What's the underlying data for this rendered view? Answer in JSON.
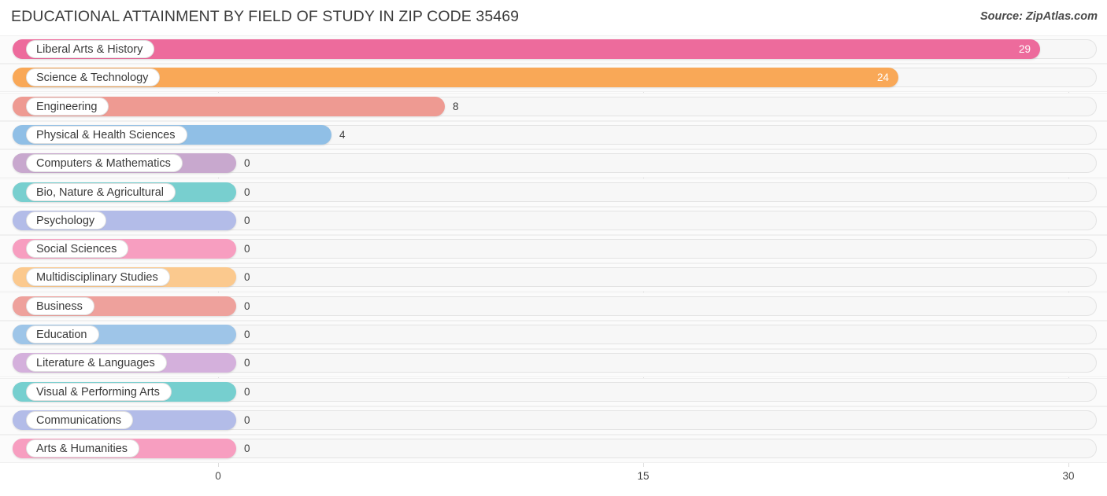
{
  "header": {
    "title": "EDUCATIONAL ATTAINMENT BY FIELD OF STUDY IN ZIP CODE 35469",
    "source": "Source: ZipAtlas.com"
  },
  "chart_data": {
    "type": "bar",
    "orientation": "horizontal",
    "title": "EDUCATIONAL ATTAINMENT BY FIELD OF STUDY IN ZIP CODE 35469",
    "xlabel": "",
    "ylabel": "",
    "xlim": [
      0,
      30
    ],
    "xticks": [
      "0",
      "15",
      "30"
    ],
    "grid": true,
    "legend": "none",
    "categories": [
      "Liberal Arts & History",
      "Science & Technology",
      "Engineering",
      "Physical & Health Sciences",
      "Computers & Mathematics",
      "Bio, Nature & Agricultural",
      "Psychology",
      "Social Sciences",
      "Multidisciplinary Studies",
      "Business",
      "Education",
      "Literature & Languages",
      "Visual & Performing Arts",
      "Communications",
      "Arts & Humanities"
    ],
    "values": [
      29,
      24,
      8,
      4,
      0,
      0,
      0,
      0,
      0,
      0,
      0,
      0,
      0,
      0,
      0
    ],
    "value_labels": [
      "29",
      "24",
      "8",
      "4",
      "0",
      "0",
      "0",
      "0",
      "0",
      "0",
      "0",
      "0",
      "0",
      "0",
      "0"
    ],
    "colors": [
      "#ED6B9C",
      "#F9A857",
      "#EE9A92",
      "#90BFE6",
      "#C8A8CE",
      "#78CFCF",
      "#B3BCE8",
      "#F79EC0",
      "#FBC98E",
      "#EEA19C",
      "#9EC5E8",
      "#D4B0DC",
      "#76CFCF",
      "#B3BCE8",
      "#F79EC0"
    ]
  }
}
